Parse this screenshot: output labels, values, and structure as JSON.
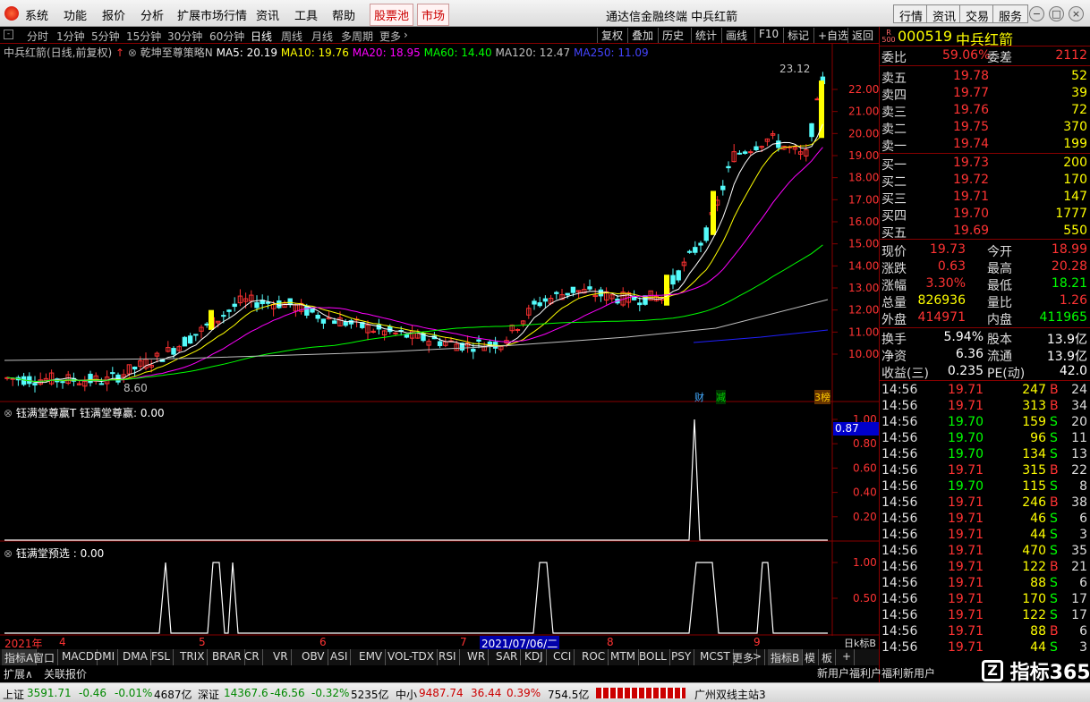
{
  "menubar": {
    "items": [
      "系统",
      "功能",
      "报价",
      "分析",
      "扩展市场行情",
      "资讯",
      "工具",
      "帮助"
    ],
    "red_items": [
      "股票池",
      "市场"
    ],
    "title": "通达信金融终端  中兵红箭",
    "right_buttons": [
      "行情",
      "资讯",
      "交易",
      "服务"
    ]
  },
  "periodbar": {
    "periods": [
      "分时",
      "1分钟",
      "5分钟",
      "15分钟",
      "30分钟",
      "60分钟",
      "日线",
      "周线",
      "月线",
      "多周期",
      "更多"
    ],
    "active": "日线",
    "tools": [
      "复权",
      "叠加",
      "历史",
      "统计",
      "画线",
      "F10",
      "标记",
      "+自选",
      "返回"
    ]
  },
  "main_chart": {
    "header": {
      "name": "中兵红箭(日线,前复权)",
      "strategy": "乾坤至尊策略N",
      "ma5": "MA5: 20.19",
      "ma10": "MA10: 19.76",
      "ma20": "MA20: 18.95",
      "ma60": "MA60: 14.40",
      "ma120": "MA120: 12.47",
      "ma250": "MA250: 11.09"
    },
    "price_labels": [
      "22.00",
      "21.00",
      "20.00",
      "19.00",
      "18.00",
      "17.00",
      "16.00",
      "15.00",
      "14.00",
      "13.00",
      "12.00",
      "11.00",
      "10.00"
    ],
    "high_label": "23.12",
    "low_label": "8.60",
    "badges": [
      "财",
      "减",
      "3榜"
    ],
    "colors": {
      "ma5": "#ffffff",
      "ma10": "#ffff00",
      "ma20": "#ff00ff",
      "ma60": "#00ff00",
      "ma120": "#c0c0c0",
      "ma250": "#2020ff",
      "up": "#ff3232",
      "down": "#54fcfc"
    }
  },
  "indicator1": {
    "header": "钰满堂尊赢T  钰满堂尊赢: 0.00",
    "value_box": "0.87",
    "axis": [
      "1.00",
      "0.80",
      "0.60",
      "0.40",
      "0.20"
    ]
  },
  "indicator2": {
    "header": "钰满堂预选 : 0.00",
    "axis": [
      "1.00",
      "0.50"
    ]
  },
  "time_axis": {
    "labels": [
      "2021年",
      "4",
      "5",
      "6",
      "7",
      "2021/07/06/二",
      "8",
      "9"
    ],
    "right_label": "日k标B"
  },
  "bottom_tabs": [
    "指标A",
    "窗口",
    "MACD",
    "DMI",
    "DMA",
    "FSL",
    "TRIX",
    "BRAR",
    "CR",
    "VR",
    "OBV",
    "ASI",
    "EMV",
    "VOL-TDX",
    "RSI",
    "WR",
    "SAR",
    "KDJ",
    "CCI",
    "ROC",
    "MTM",
    "BOLL",
    "PSY",
    "MCST",
    "更多",
    ">",
    "指标B",
    "模",
    "板",
    "+"
  ],
  "ext_bar": [
    "扩展∧",
    "关联报价"
  ],
  "quote": {
    "code": "000519",
    "name": "中兵红箭",
    "weibi_label": "委比",
    "weibi": "59.06%",
    "weicha_label": "委差",
    "weicha": "2112",
    "sell": [
      {
        "label": "卖五",
        "price": "19.78",
        "vol": "52"
      },
      {
        "label": "卖四",
        "price": "19.77",
        "vol": "39"
      },
      {
        "label": "卖三",
        "price": "19.76",
        "vol": "72"
      },
      {
        "label": "卖二",
        "price": "19.75",
        "vol": "370"
      },
      {
        "label": "卖一",
        "price": "19.74",
        "vol": "199"
      }
    ],
    "buy": [
      {
        "label": "买一",
        "price": "19.73",
        "vol": "200"
      },
      {
        "label": "买二",
        "price": "19.72",
        "vol": "170"
      },
      {
        "label": "买三",
        "price": "19.71",
        "vol": "147"
      },
      {
        "label": "买四",
        "price": "19.70",
        "vol": "1777"
      },
      {
        "label": "买五",
        "price": "19.69",
        "vol": "550"
      }
    ],
    "stats": [
      {
        "l1": "现价",
        "v1": "19.73",
        "l2": "今开",
        "v2": "18.99"
      },
      {
        "l1": "涨跌",
        "v1": "0.63",
        "l2": "最高",
        "v2": "20.28"
      },
      {
        "l1": "涨幅",
        "v1": "3.30%",
        "l2": "最低",
        "v2": "18.21"
      },
      {
        "l1": "总量",
        "v1": "826936",
        "l2": "量比",
        "v2": "1.26"
      },
      {
        "l1": "外盘",
        "v1": "414971",
        "l2": "内盘",
        "v2": "411965"
      }
    ],
    "stats2": [
      {
        "l1": "换手",
        "v1": "5.94%",
        "l2": "股本",
        "v2": "13.9亿"
      },
      {
        "l1": "净资",
        "v1": "6.36",
        "l2": "流通",
        "v2": "13.9亿"
      },
      {
        "l1": "收益(三)",
        "v1": "0.235",
        "l2": "PE(动)",
        "v2": "42.0"
      }
    ],
    "ticks": [
      {
        "t": "14:56",
        "p": "19.71",
        "v": "247",
        "d": "B",
        "n": "24"
      },
      {
        "t": "14:56",
        "p": "19.71",
        "v": "313",
        "d": "B",
        "n": "34"
      },
      {
        "t": "14:56",
        "p": "19.70",
        "v": "159",
        "d": "S",
        "n": "20"
      },
      {
        "t": "14:56",
        "p": "19.70",
        "v": "96",
        "d": "S",
        "n": "11"
      },
      {
        "t": "14:56",
        "p": "19.70",
        "v": "134",
        "d": "S",
        "n": "13"
      },
      {
        "t": "14:56",
        "p": "19.71",
        "v": "315",
        "d": "B",
        "n": "22"
      },
      {
        "t": "14:56",
        "p": "19.70",
        "v": "115",
        "d": "S",
        "n": "8"
      },
      {
        "t": "14:56",
        "p": "19.71",
        "v": "246",
        "d": "B",
        "n": "38"
      },
      {
        "t": "14:56",
        "p": "19.71",
        "v": "46",
        "d": "S",
        "n": "6"
      },
      {
        "t": "14:56",
        "p": "19.71",
        "v": "44",
        "d": "S",
        "n": "3"
      },
      {
        "t": "14:56",
        "p": "19.71",
        "v": "470",
        "d": "S",
        "n": "35"
      },
      {
        "t": "14:56",
        "p": "19.71",
        "v": "122",
        "d": "B",
        "n": "21"
      },
      {
        "t": "14:56",
        "p": "19.71",
        "v": "88",
        "d": "S",
        "n": "6"
      },
      {
        "t": "14:56",
        "p": "19.71",
        "v": "170",
        "d": "S",
        "n": "17"
      },
      {
        "t": "14:56",
        "p": "19.71",
        "v": "122",
        "d": "S",
        "n": "17"
      },
      {
        "t": "14:56",
        "p": "19.71",
        "v": "88",
        "d": "B",
        "n": "6"
      },
      {
        "t": "14:56",
        "p": "19.71",
        "v": "44",
        "d": "S",
        "n": "3"
      }
    ],
    "footer": "新用户福利户福利新用户",
    "watermark": "指标365"
  },
  "statusbar": {
    "sh_label": "上证",
    "sh": "3591.71",
    "sh_chg": "-0.46",
    "sh_pct": "-0.01%",
    "sh_amt": "4687亿",
    "sz_label": "深证",
    "sz": "14367.6",
    "sz_chg": "-46.56",
    "sz_pct": "-0.32%",
    "sz_amt": "5235亿",
    "zx_label": "中小",
    "zx": "9487.74",
    "zx_chg": "36.44",
    "zx_pct": "0.39%",
    "zx_amt": "754.5亿",
    "server": "广州双线主站3"
  }
}
